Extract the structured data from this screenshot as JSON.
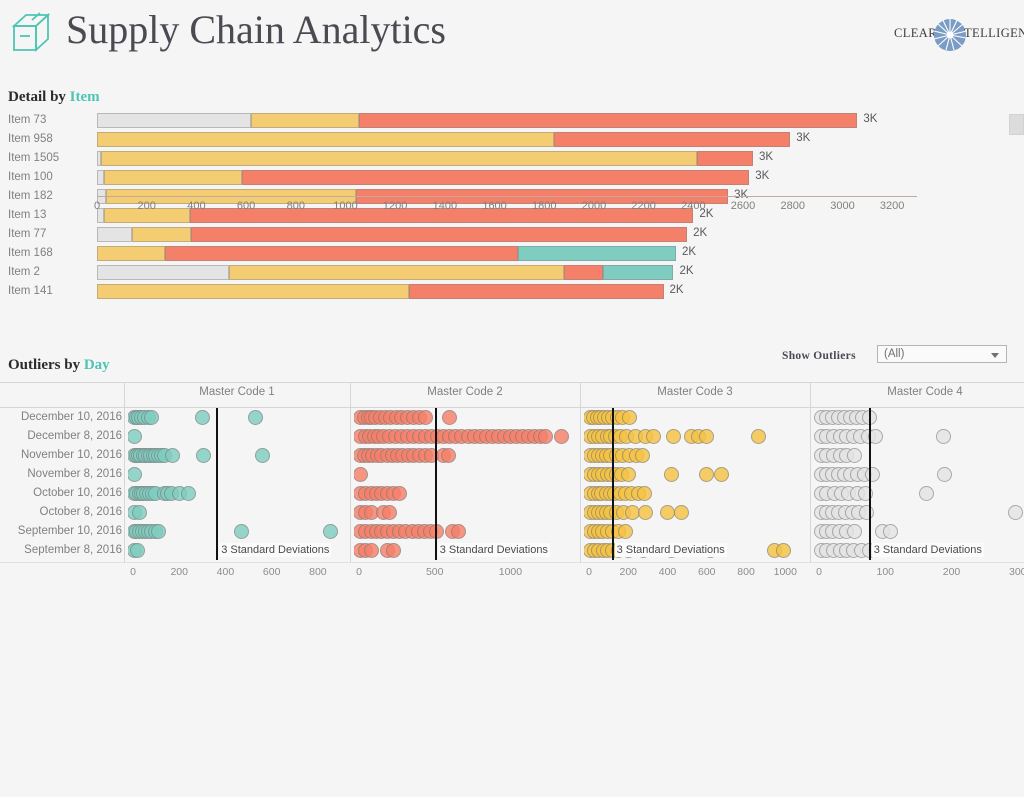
{
  "header": {
    "title": "Supply Chain Analytics",
    "logo_icon": "box-package-icon",
    "brand_left": "CLEAR",
    "brand_right": "TELLIGENCE",
    "brand_icon": "sunburst-orb-icon"
  },
  "sections": {
    "detail": {
      "prefix": "Detail by ",
      "accent": "Item"
    },
    "outliers": {
      "prefix": "Outliers by ",
      "accent": "Day"
    }
  },
  "filter": {
    "label": "Show Outliers",
    "value": "(All)",
    "caret_icon": "chevron-down-icon"
  },
  "colors": {
    "gray": "#e4e4e4",
    "yellow": "#f4cd73",
    "salmon": "#f5806a",
    "teal": "#7fcdc0",
    "accent_text": "#4ec5b3",
    "refline": "#111111",
    "page_bg": "#f5f5f5"
  },
  "chart_data": [
    {
      "type": "bar",
      "subtype": "stacked-horizontal",
      "title": "Detail by Item",
      "xlabel": "",
      "ylabel": "",
      "xlim": [
        0,
        3300
      ],
      "grid": false,
      "legend": false,
      "tick_labels": [
        0,
        200,
        400,
        600,
        800,
        1000,
        1200,
        1400,
        1600,
        1800,
        2000,
        2200,
        2400,
        2600,
        2800,
        3000,
        3200
      ],
      "stack_names": [
        "gray",
        "yellow",
        "salmon",
        "teal"
      ],
      "categories": [
        "Item 73",
        "Item 958",
        "Item 1505",
        "Item 100",
        "Item 182",
        "Item 13",
        "Item 77",
        "Item 168",
        "Item 2",
        "Item 141"
      ],
      "data_labels": [
        "3K",
        "3K",
        "3K",
        "3K",
        "3K",
        "2K",
        "2K",
        "2K",
        "2K",
        "2K"
      ],
      "rows": [
        {
          "category": "Item 73",
          "total": 3060,
          "label": "3K",
          "segments": [
            {
              "color": "gray",
              "value": 620
            },
            {
              "color": "yellow",
              "value": 435
            },
            {
              "color": "salmon",
              "value": 2005
            },
            {
              "color": "teal",
              "value": 0
            }
          ]
        },
        {
          "category": "Item 958",
          "total": 2790,
          "label": "3K",
          "segments": [
            {
              "color": "gray",
              "value": 0
            },
            {
              "color": "yellow",
              "value": 1840
            },
            {
              "color": "salmon",
              "value": 950
            },
            {
              "color": "teal",
              "value": 0
            }
          ]
        },
        {
          "category": "Item 1505",
          "total": 2640,
          "label": "3K",
          "segments": [
            {
              "color": "gray",
              "value": 18
            },
            {
              "color": "yellow",
              "value": 2395
            },
            {
              "color": "salmon",
              "value": 227
            },
            {
              "color": "teal",
              "value": 0
            }
          ]
        },
        {
          "category": "Item 100",
          "total": 2625,
          "label": "3K",
          "segments": [
            {
              "color": "gray",
              "value": 30
            },
            {
              "color": "yellow",
              "value": 555
            },
            {
              "color": "salmon",
              "value": 2040
            },
            {
              "color": "teal",
              "value": 0
            }
          ]
        },
        {
          "category": "Item 182",
          "total": 2540,
          "label": "3K",
          "segments": [
            {
              "color": "gray",
              "value": 36
            },
            {
              "color": "yellow",
              "value": 1005
            },
            {
              "color": "salmon",
              "value": 1499
            },
            {
              "color": "teal",
              "value": 0
            }
          ]
        },
        {
          "category": "Item 13",
          "total": 2400,
          "label": "2K",
          "segments": [
            {
              "color": "gray",
              "value": 30
            },
            {
              "color": "yellow",
              "value": 345
            },
            {
              "color": "salmon",
              "value": 2025
            },
            {
              "color": "teal",
              "value": 0
            }
          ]
        },
        {
          "category": "Item 77",
          "total": 2375,
          "label": "2K",
          "segments": [
            {
              "color": "gray",
              "value": 140
            },
            {
              "color": "yellow",
              "value": 240
            },
            {
              "color": "salmon",
              "value": 1995
            },
            {
              "color": "teal",
              "value": 0
            }
          ]
        },
        {
          "category": "Item 168",
          "total": 2330,
          "label": "2K",
          "segments": [
            {
              "color": "gray",
              "value": 0
            },
            {
              "color": "yellow",
              "value": 275
            },
            {
              "color": "salmon",
              "value": 1420
            },
            {
              "color": "teal",
              "value": 635
            }
          ]
        },
        {
          "category": "Item 2",
          "total": 2320,
          "label": "2K",
          "segments": [
            {
              "color": "gray",
              "value": 530
            },
            {
              "color": "yellow",
              "value": 1350
            },
            {
              "color": "salmon",
              "value": 155
            },
            {
              "color": "teal",
              "value": 285
            }
          ]
        },
        {
          "category": "Item 141",
          "total": 2280,
          "label": "2K",
          "segments": [
            {
              "color": "gray",
              "value": 0
            },
            {
              "color": "yellow",
              "value": 1255
            },
            {
              "color": "salmon",
              "value": 1025
            },
            {
              "color": "teal",
              "value": 0
            }
          ]
        }
      ]
    },
    {
      "type": "scatter",
      "subtype": "dot-plot-small-multiples",
      "title": "Outliers by Day",
      "ylabel": "",
      "xlabel": "",
      "grid": false,
      "legend": false,
      "reference_line_label": "3 Standard Deviations",
      "rows": [
        "December 10, 2016",
        "December 8, 2016",
        "November 10, 2016",
        "November 8, 2016",
        "October 10, 2016",
        "October 8, 2016",
        "September 10, 2016",
        "September 8, 2016"
      ],
      "panels": [
        {
          "name": "Master Code 1",
          "color": "teal",
          "xlim": [
            0,
            900
          ],
          "ticks": [
            0,
            200,
            400,
            600,
            800
          ],
          "reference_line": 360,
          "series": [
            {
              "row": "December 10, 2016",
              "values": [
                5,
                15,
                25,
                38,
                50,
                65,
                78,
                300,
                530
              ]
            },
            {
              "row": "December 8, 2016",
              "values": [
                8
              ]
            },
            {
              "row": "November 10, 2016",
              "values": [
                5,
                14,
                24,
                33,
                44,
                56,
                66,
                76,
                88,
                98,
                110,
                122,
                135,
                170,
                305,
                560
              ]
            },
            {
              "row": "November 8, 2016",
              "values": [
                8
              ]
            },
            {
              "row": "October 10, 2016",
              "values": [
                5,
                15,
                26,
                36,
                46,
                58,
                70,
                84,
                96,
                135,
                150,
                168,
                200,
                240
              ]
            },
            {
              "row": "October 8, 2016",
              "values": [
                7,
                30
              ]
            },
            {
              "row": "September 10, 2016",
              "values": [
                6,
                17,
                28,
                40,
                52,
                66,
                80,
                96,
                112,
                470,
                855
              ]
            },
            {
              "row": "September 8, 2016",
              "values": [
                5,
                18
              ]
            }
          ]
        },
        {
          "name": "Master Code 2",
          "color": "salmon",
          "xlim": [
            0,
            1400
          ],
          "ticks": [
            0,
            500,
            1000
          ],
          "reference_line": 500,
          "series": [
            {
              "row": "December 10, 2016",
              "values": [
                10,
                35,
                60,
                85,
                110,
                140,
                175,
                210,
                245,
                280,
                320,
                360,
                400,
                440,
                600
              ]
            },
            {
              "row": "December 8, 2016",
              "values": [
                10,
                40,
                70,
                100,
                130,
                160,
                200,
                240,
                280,
                320,
                360,
                400,
                440,
                480,
                520,
                560,
                600,
                640,
                680,
                720,
                760,
                800,
                840,
                880,
                920,
                960,
                1000,
                1040,
                1080,
                1120,
                1160,
                1200,
                1230,
                1340
              ]
            },
            {
              "row": "November 10, 2016",
              "values": [
                10,
                35,
                60,
                90,
                120,
                150,
                185,
                220,
                255,
                290,
                325,
                360,
                400,
                440,
                480,
                560,
                590
              ]
            },
            {
              "row": "November 8, 2016",
              "values": [
                10
              ]
            },
            {
              "row": "October 10, 2016",
              "values": [
                10,
                45,
                80,
                115,
                150,
                190,
                230,
                270
              ]
            },
            {
              "row": "October 8, 2016",
              "values": [
                10,
                45,
                80,
                160,
                200
              ]
            },
            {
              "row": "September 10, 2016",
              "values": [
                12,
                45,
                80,
                115,
                150,
                190,
                230,
                270,
                310,
                350,
                390,
                430,
                470,
                510,
                620,
                660
              ]
            },
            {
              "row": "September 8, 2016",
              "values": [
                10,
                45,
                80,
                190,
                230
              ]
            }
          ]
        },
        {
          "name": "Master Code 3",
          "color": "gold",
          "xlim": [
            0,
            1080
          ],
          "ticks": [
            0,
            200,
            400,
            600,
            800,
            1000
          ],
          "reference_line": 115,
          "series": [
            {
              "row": "December 10, 2016",
              "values": [
                8,
                25,
                42,
                60,
                80,
                100,
                122,
                145,
                170,
                205
              ]
            },
            {
              "row": "December 8, 2016",
              "values": [
                8,
                28,
                48,
                70,
                92,
                112,
                135,
                160,
                190,
                235,
                290,
                330,
                430,
                520,
                560,
                600,
                865
              ]
            },
            {
              "row": "November 10, 2016",
              "values": [
                8,
                26,
                46,
                68,
                90,
                112,
                140,
                172,
                205,
                240,
                270
              ]
            },
            {
              "row": "November 8, 2016",
              "values": [
                8,
                26,
                48,
                70,
                92,
                115,
                140,
                168,
                200,
                420,
                600,
                675
              ]
            },
            {
              "row": "October 10, 2016",
              "values": [
                8,
                26,
                46,
                66,
                88,
                110,
                132,
                158,
                186,
                215,
                250,
                285
              ]
            },
            {
              "row": "October 8, 2016",
              "values": [
                8,
                26,
                46,
                68,
                90,
                112,
                140,
                175,
                220,
                290,
                400,
                470
              ]
            },
            {
              "row": "September 10, 2016",
              "values": [
                8,
                26,
                46,
                68,
                92,
                120,
                150,
                185
              ]
            },
            {
              "row": "September 8, 2016",
              "values": [
                8,
                28,
                50,
                72,
                95,
                120,
                150,
                200,
                280,
                420,
                620,
                945,
                990
              ]
            }
          ]
        },
        {
          "name": "Master Code 4",
          "color": "gray",
          "xlim": [
            0,
            320
          ],
          "ticks": [
            0,
            100,
            200,
            300
          ],
          "reference_line": 75,
          "series": [
            {
              "row": "December 10, 2016",
              "values": [
                3,
                11,
                20,
                29,
                38,
                47,
                56,
                66,
                76
              ]
            },
            {
              "row": "December 8, 2016",
              "values": [
                3,
                12,
                22,
                32,
                42,
                52,
                63,
                74,
                85,
                188
              ]
            },
            {
              "row": "November 10, 2016",
              "values": [
                3,
                12,
                22,
                32,
                42,
                53
              ]
            },
            {
              "row": "November 8, 2016",
              "values": [
                3,
                11,
                20,
                29,
                38,
                48,
                58,
                68,
                80,
                190
              ]
            },
            {
              "row": "October 10, 2016",
              "values": [
                3,
                12,
                23,
                34,
                45,
                58,
                70,
                163
              ]
            },
            {
              "row": "October 8, 2016",
              "values": [
                3,
                11,
                20,
                30,
                40,
                50,
                60,
                72,
                296
              ]
            },
            {
              "row": "September 10, 2016",
              "values": [
                3,
                11,
                21,
                31,
                42,
                53,
                96,
                108
              ]
            },
            {
              "row": "September 8, 2016",
              "values": [
                3,
                12,
                22,
                32,
                42,
                52,
                64,
                76
              ]
            }
          ]
        }
      ]
    }
  ]
}
